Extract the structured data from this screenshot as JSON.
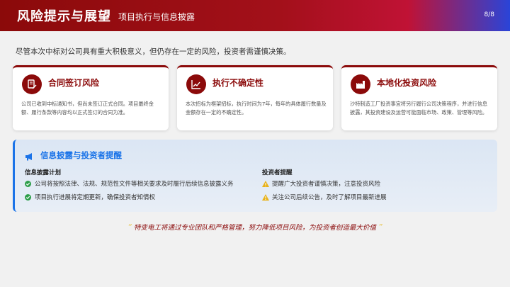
{
  "header": {
    "title": "风险提示与展望",
    "subtitle": "项目执行与信息披露",
    "page": "8/8"
  },
  "intro": "尽管本次中标对公司具有重大积极意义，但仍存在一定的风险，投资者需谨慎决策。",
  "cards": [
    {
      "title": "合同签订风险",
      "icon": "contract-icon",
      "text": "公司已收到中标通知书，但尚未签订正式合同。项目最终金额、履行条款等内容均以正式签订的合同为准。"
    },
    {
      "title": "执行不确定性",
      "icon": "chart-line-icon",
      "text": "本次招标为框架招标，执行时间为7年，每年的具体履行数量及金额存在一定的不确定性。"
    },
    {
      "title": "本地化投资风险",
      "icon": "factory-icon",
      "text": "沙特制造工厂投资事宜将另行履行公司决策程序，并进行信息披露，其投资建设及运营可能面临市场、政策、管理等风险。"
    }
  ],
  "info": {
    "title": "信息披露与投资者提醒",
    "disclosure": {
      "heading": "信息披露计划",
      "items": [
        "公司将按照法律、法规、规范性文件等相关要求及时履行后续信息披露义务",
        "项目执行进展将定期更新，确保投资者知情权"
      ]
    },
    "investor": {
      "heading": "投资者提醒",
      "items": [
        "提醒广大投资者谨慎决策，注意投资风险",
        "关注公司后续公告，及时了解项目最新进展"
      ]
    }
  },
  "footer": {
    "quote": "特变电工将通过专业团队和严格管理，努力降低项目风险，为投资者创造最大价值"
  },
  "colors": {
    "brand_red": "#8b0a0a",
    "accent_blue": "#1a73e8",
    "check_green": "#2e9e4a",
    "warn_yellow": "#e8b21a"
  }
}
